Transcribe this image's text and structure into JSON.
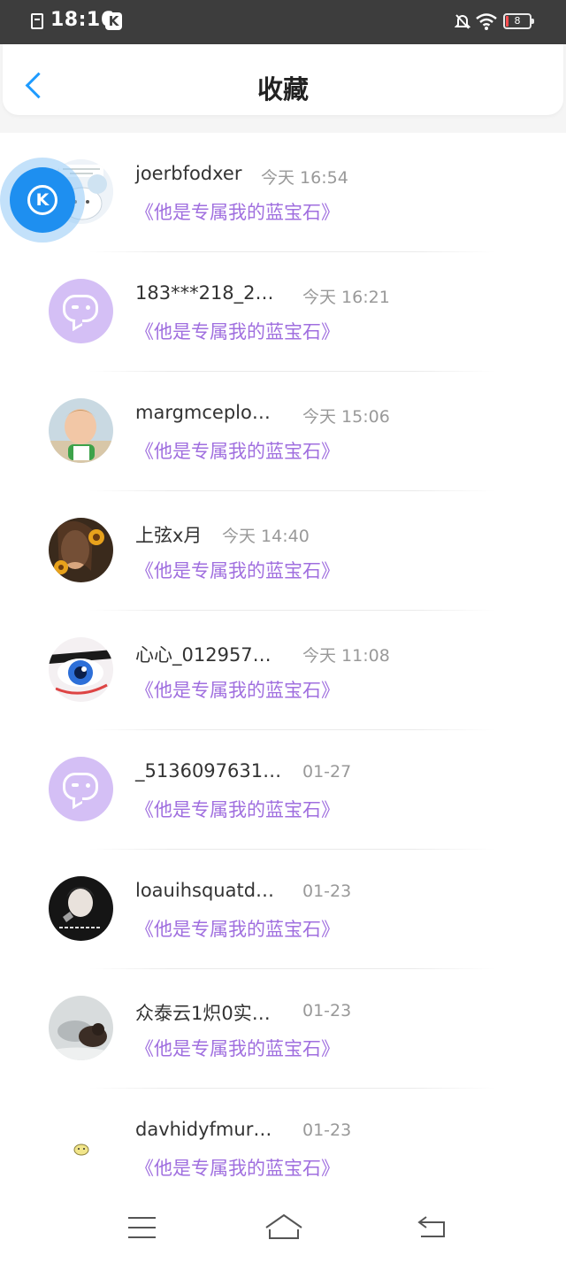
{
  "status_bar": {
    "time": "18:16",
    "app_badge": "K",
    "battery_level": "8"
  },
  "header": {
    "title": "收藏"
  },
  "floating_ball": {
    "letter": "K"
  },
  "favorites": [
    {
      "name": "joerbfodxer",
      "time": "今天 16:54",
      "song": "《他是专属我的蓝宝石》",
      "avatar": "sticker"
    },
    {
      "name": "183***218_2…",
      "time": "今天 16:21",
      "song": "《他是专属我的蓝宝石》",
      "avatar": "bubble"
    },
    {
      "name": "margmceplo…",
      "time": "今天 15:06",
      "song": "《他是专属我的蓝宝石》",
      "avatar": "baby"
    },
    {
      "name": "上弦x月",
      "time": "今天 14:40",
      "song": "《他是专属我的蓝宝石》",
      "avatar": "sunflower"
    },
    {
      "name": "心心_012957…",
      "time": "今天 11:08",
      "song": "《他是专属我的蓝宝石》",
      "avatar": "eye"
    },
    {
      "name": "_5136097631…",
      "time": "01-27",
      "song": "《他是专属我的蓝宝石》",
      "avatar": "bubble"
    },
    {
      "name": "loauihsquatd…",
      "time": "01-23",
      "song": "《他是专属我的蓝宝石》",
      "avatar": "girl"
    },
    {
      "name": "众泰云1炽0实…",
      "time": "01-23",
      "song": "《他是专属我的蓝宝石》",
      "avatar": "cat"
    },
    {
      "name": "davhidyfmur…",
      "time": "01-23",
      "song": "《他是专属我的蓝宝石》",
      "avatar": "emoji"
    }
  ],
  "colors": {
    "accent": "#1e9bff",
    "song_text": "#a06fdf",
    "time_text": "#999999",
    "default_avatar": "#d4bff5"
  },
  "icons": [
    "back-icon",
    "menu-icon",
    "home-icon",
    "back-nav-icon",
    "wifi-icon",
    "mute-icon",
    "battery-icon"
  ]
}
